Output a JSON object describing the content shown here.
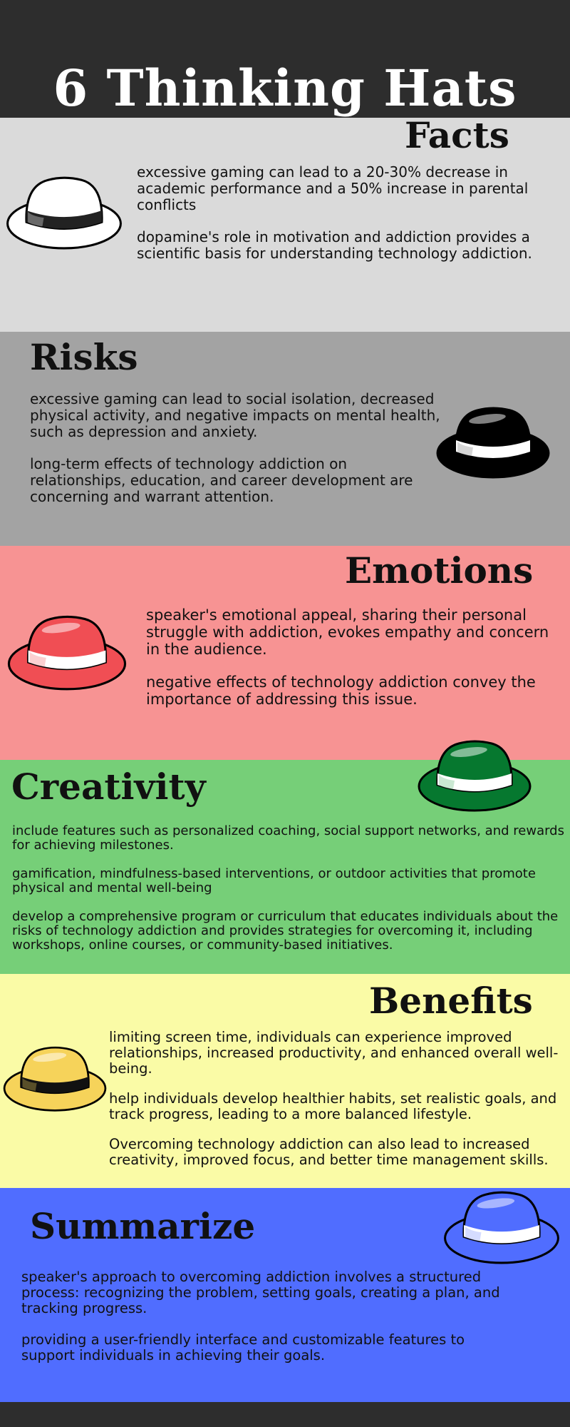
{
  "title": "6 Thinking Hats",
  "colors": {
    "header_bg": "#2d2d2d",
    "facts_bg": "#dadada",
    "risks_bg": "#a3a3a3",
    "emotions_bg": "#f79393",
    "creativity_bg": "#76cf78",
    "benefits_bg": "#fafba6",
    "summarize_bg": "#506dff",
    "hat_white": "#ffffff",
    "hat_black": "#000000",
    "hat_red": "#f04e54",
    "hat_green": "#06782f",
    "hat_yellow": "#f6d35a",
    "hat_blue": "#506dff"
  },
  "sections": {
    "facts": {
      "title": "Facts",
      "hat": "white-hat-icon",
      "paragraphs": [
        "excessive gaming can lead to a 20-30% decrease in academic performance and a 50% increase in parental conflicts",
        "dopamine's role in motivation and addiction provides a scientific basis for understanding technology addiction."
      ]
    },
    "risks": {
      "title": "Risks",
      "hat": "black-hat-icon",
      "paragraphs": [
        "excessive gaming can lead to social isolation, decreased physical activity, and negative impacts on mental health, such as depression and anxiety.",
        "long-term effects of technology addiction on relationships, education, and career development are concerning and warrant attention."
      ]
    },
    "emotions": {
      "title": "Emotions",
      "hat": "red-hat-icon",
      "paragraphs": [
        "speaker's emotional appeal, sharing their personal struggle with addiction, evokes empathy and concern in the audience.",
        "negative effects of technology addiction convey the importance of addressing this issue."
      ]
    },
    "creativity": {
      "title": "Creativity",
      "hat": "green-hat-icon",
      "paragraphs": [
        "include features such as personalized coaching, social support networks, and rewards for achieving milestones.",
        "gamification, mindfulness-based interventions, or outdoor activities that promote physical and mental well-being",
        "develop a comprehensive program or curriculum that educates individuals about the risks of technology addiction and provides strategies for overcoming it, including workshops, online courses, or community-based initiatives."
      ]
    },
    "benefits": {
      "title": "Benefits",
      "hat": "yellow-hat-icon",
      "paragraphs": [
        "limiting screen time, individuals can experience improved relationships, increased productivity, and enhanced overall well-being.",
        "help individuals develop healthier habits, set realistic goals, and track progress, leading to a more balanced lifestyle.",
        "Overcoming technology addiction can also lead to increased creativity, improved focus, and better time management skills."
      ]
    },
    "summarize": {
      "title": "Summarize",
      "hat": "blue-hat-icon",
      "paragraphs": [
        "speaker's approach to overcoming addiction involves a structured process: recognizing the problem, setting goals, creating a plan, and tracking progress.",
        "providing a user-friendly interface and customizable features to support individuals in achieving their goals."
      ]
    }
  }
}
